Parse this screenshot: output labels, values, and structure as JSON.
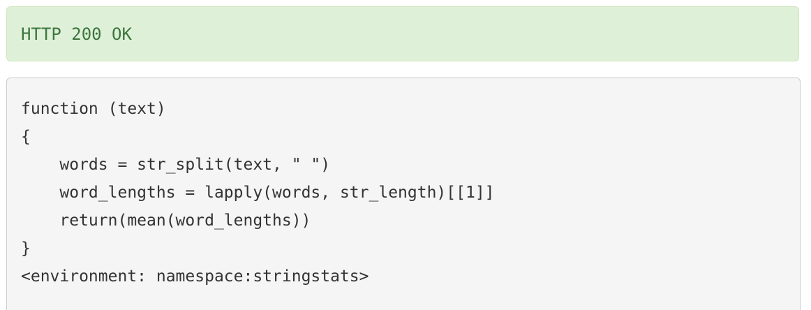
{
  "response": {
    "status": "HTTP 200 OK"
  },
  "code": {
    "lines": [
      "function (text)",
      "{",
      "    words = str_split(text, \" \")",
      "    word_lengths = lapply(words, str_length)[[1]]",
      "    return(mean(word_lengths))",
      "}",
      "<environment: namespace:stringstats>"
    ]
  },
  "colors": {
    "success_bg": "#dff0d8",
    "success_text": "#3c763d",
    "code_bg": "#f5f5f5",
    "code_border": "#cccccc",
    "code_text": "#333333"
  }
}
